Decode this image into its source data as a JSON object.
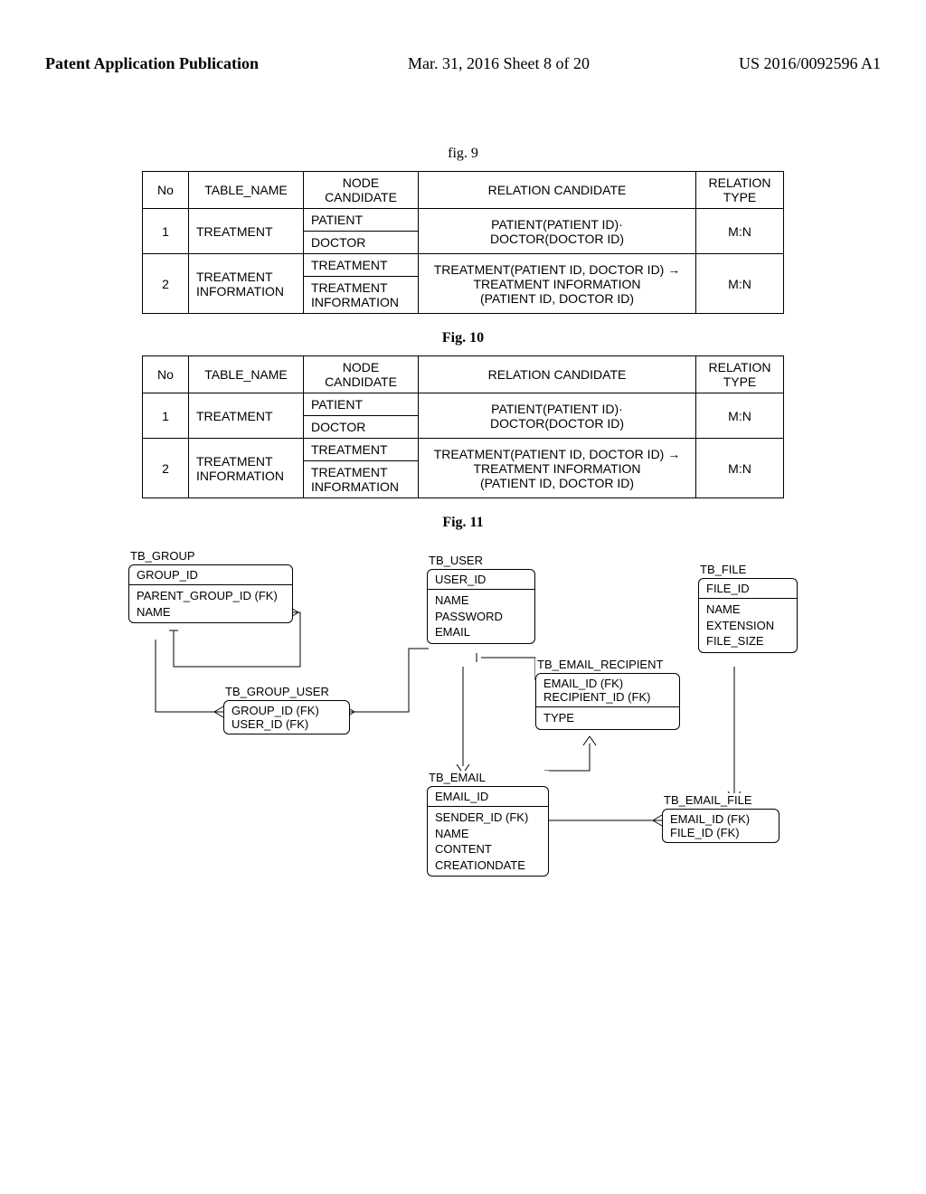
{
  "header": {
    "left": "Patent Application Publication",
    "center": "Mar. 31, 2016  Sheet 8 of 20",
    "right": "US 2016/0092596 A1"
  },
  "fig9": {
    "label": "fig. 9",
    "headers": {
      "no": "No",
      "table_name": "TABLE_NAME",
      "node_candidate": "NODE\nCANDIDATE",
      "relation_candidate": "RELATION CANDIDATE",
      "relation_type": "RELATION\nTYPE"
    },
    "rows": [
      {
        "no": "1",
        "table_name": "TREATMENT",
        "node1": "PATIENT",
        "node2": "DOCTOR",
        "relation": "PATIENT(PATIENT ID)·\nDOCTOR(DOCTOR ID)",
        "type": "M:N"
      },
      {
        "no": "2",
        "table_name": "TREATMENT\nINFORMATION",
        "node1": "TREATMENT",
        "node2": "TREATMENT\nINFORMATION",
        "relation": "TREATMENT(PATIENT ID, DOCTOR ID) →\nTREATMENT INFORMATION\n(PATIENT ID, DOCTOR ID)",
        "type": "M:N"
      }
    ]
  },
  "fig10": {
    "label": "Fig. 10",
    "headers": {
      "no": "No",
      "table_name": "TABLE_NAME",
      "node_candidate": "NODE\nCANDIDATE",
      "relation_candidate": "RELATION CANDIDATE",
      "relation_type": "RELATION\nTYPE"
    },
    "rows": [
      {
        "no": "1",
        "table_name": "TREATMENT",
        "node1": "PATIENT",
        "node2": "DOCTOR",
        "relation": "PATIENT(PATIENT ID)·\nDOCTOR(DOCTOR ID)",
        "type": "M:N"
      },
      {
        "no": "2",
        "table_name": "TREATMENT\nINFORMATION",
        "node1": "TREATMENT",
        "node2": "TREATMENT\nINFORMATION",
        "relation": "TREATMENT(PATIENT ID, DOCTOR ID) →\nTREATMENT INFORMATION\n(PATIENT ID, DOCTOR ID)",
        "type": "M:N"
      }
    ]
  },
  "fig11": {
    "label": "Fig. 11",
    "entities": {
      "tb_group": {
        "title": "TB_GROUP",
        "pk": "GROUP_ID",
        "attrs": "PARENT_GROUP_ID (FK)\nNAME"
      },
      "tb_group_user": {
        "title": "TB_GROUP_USER",
        "pk": "GROUP_ID (FK)\nUSER_ID (FK)"
      },
      "tb_user": {
        "title": "TB_USER",
        "pk": "USER_ID",
        "attrs": "NAME\nPASSWORD\nEMAIL"
      },
      "tb_email_recipient": {
        "title": "TB_EMAIL_RECIPIENT",
        "pk": "EMAIL_ID (FK)\nRECIPIENT_ID (FK)",
        "attrs": "TYPE"
      },
      "tb_file": {
        "title": "TB_FILE",
        "pk": "FILE_ID",
        "attrs": "NAME\nEXTENSION\nFILE_SIZE"
      },
      "tb_email": {
        "title": "TB_EMAIL",
        "pk": "EMAIL_ID",
        "attrs": "SENDER_ID (FK)\nNAME\nCONTENT\nCREATIONDATE"
      },
      "tb_email_file": {
        "title": "TB_EMAIL_FILE",
        "pk": "EMAIL_ID (FK)\nFILE_ID (FK)"
      }
    }
  }
}
